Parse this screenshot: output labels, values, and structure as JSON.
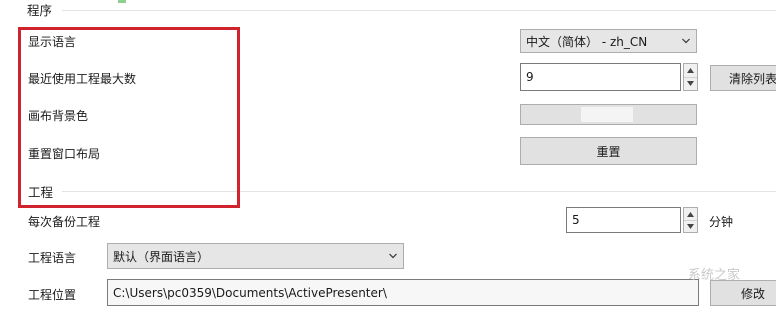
{
  "program_section": {
    "title": "程序",
    "display_language": {
      "label": "显示语言",
      "value": "中文（简体） - zh_CN"
    },
    "recent_projects": {
      "label": "最近使用工程最大数",
      "value": "9",
      "clear_button": "清除列表"
    },
    "canvas_background": {
      "label": "画布背景色"
    },
    "reset_layout": {
      "label": "重置窗口布局",
      "button": "重置"
    }
  },
  "project_section": {
    "title": "工程",
    "backup_interval": {
      "label": "每次备份工程",
      "value": "5",
      "unit": "分钟"
    },
    "project_language": {
      "label": "工程语言",
      "value": "默认（界面语言）"
    },
    "project_location": {
      "label": "工程位置",
      "value": "C:\\Users\\pc0359\\Documents\\ActivePresenter\\",
      "button": "修改"
    }
  },
  "watermark": "系统之家",
  "colors": {
    "highlight_border": "#d0232e",
    "button_bg": "#e1e1e1",
    "border": "#adadad"
  }
}
